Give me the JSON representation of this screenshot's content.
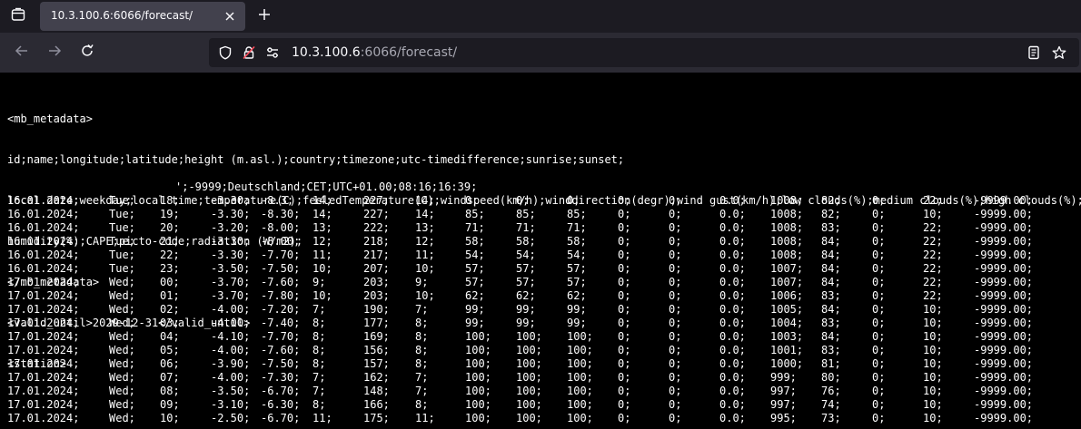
{
  "tab": {
    "title": "10.3.100.6:6066/forecast/"
  },
  "url": {
    "host": "10.3.100.6",
    "rest": ":6066/forecast/"
  },
  "metadata_lines": [
    "<mb_metadata>",
    "id;name;longitude;latitude;height (m.asl.);country;timezone;utc-timedifference;sunrise;sunset;",
    "local date;weekday;local time;temperature(C);feeledTemperature(C);windspeed(km/h);winddirection(degr);wind gust(km/h);low clouds(%);medium clouds(%);high clouds(%);precipitation(mm);",
    "humidity(%);CAPE;picto-code;radiation (W/m2);",
    "</mb_metadata>",
    "<valid_until>2029-12-31</valid_until>",
    "<station>"
  ],
  "station_line": "';-9999;Deutschland;CET;UTC+01.00;08:16;16:39;",
  "rows": [
    [
      "16.01.2024;",
      "Tue;",
      "18;",
      "-3.30;",
      "-8.3;",
      "14;",
      "227;",
      "14;",
      "0;",
      "0;",
      "0;",
      "0;",
      "0;",
      "0.0;",
      "1008;",
      "82;",
      "0;",
      "22;",
      "-9999.00;"
    ],
    [
      "16.01.2024;",
      "Tue;",
      "19;",
      "-3.30;",
      "-8.30;",
      "14;",
      "227;",
      "14;",
      "85;",
      "85;",
      "85;",
      "0;",
      "0;",
      "0.0;",
      "1008;",
      "82;",
      "0;",
      "10;",
      "-9999.00;"
    ],
    [
      "16.01.2024;",
      "Tue;",
      "20;",
      "-3.20;",
      "-8.00;",
      "13;",
      "222;",
      "13;",
      "71;",
      "71;",
      "71;",
      "0;",
      "0;",
      "0.0;",
      "1008;",
      "83;",
      "0;",
      "22;",
      "-9999.00;"
    ],
    [
      "16.01.2024;",
      "Tue;",
      "21;",
      "-3.30;",
      "-8.00;",
      "12;",
      "218;",
      "12;",
      "58;",
      "58;",
      "58;",
      "0;",
      "0;",
      "0.0;",
      "1008;",
      "84;",
      "0;",
      "22;",
      "-9999.00;"
    ],
    [
      "16.01.2024;",
      "Tue;",
      "22;",
      "-3.30;",
      "-7.70;",
      "11;",
      "217;",
      "11;",
      "54;",
      "54;",
      "54;",
      "0;",
      "0;",
      "0.0;",
      "1008;",
      "84;",
      "0;",
      "22;",
      "-9999.00;"
    ],
    [
      "16.01.2024;",
      "Tue;",
      "23;",
      "-3.50;",
      "-7.50;",
      "10;",
      "207;",
      "10;",
      "57;",
      "57;",
      "57;",
      "0;",
      "0;",
      "0.0;",
      "1007;",
      "84;",
      "0;",
      "22;",
      "-9999.00;"
    ],
    [
      "17.01.2024;",
      "Wed;",
      "00;",
      "-3.70;",
      "-7.60;",
      "9;",
      "203;",
      "9;",
      "57;",
      "57;",
      "57;",
      "0;",
      "0;",
      "0.0;",
      "1007;",
      "84;",
      "0;",
      "22;",
      "-9999.00;"
    ],
    [
      "17.01.2024;",
      "Wed;",
      "01;",
      "-3.70;",
      "-7.80;",
      "10;",
      "203;",
      "10;",
      "62;",
      "62;",
      "62;",
      "0;",
      "0;",
      "0.0;",
      "1006;",
      "83;",
      "0;",
      "22;",
      "-9999.00;"
    ],
    [
      "17.01.2024;",
      "Wed;",
      "02;",
      "-4.00;",
      "-7.20;",
      "7;",
      "190;",
      "7;",
      "99;",
      "99;",
      "99;",
      "0;",
      "0;",
      "0.0;",
      "1005;",
      "84;",
      "0;",
      "10;",
      "-9999.00;"
    ],
    [
      "17.01.2024;",
      "Wed;",
      "03;",
      "-4.00;",
      "-7.40;",
      "8;",
      "177;",
      "8;",
      "99;",
      "99;",
      "99;",
      "0;",
      "0;",
      "0.0;",
      "1004;",
      "83;",
      "0;",
      "10;",
      "-9999.00;"
    ],
    [
      "17.01.2024;",
      "Wed;",
      "04;",
      "-4.10;",
      "-7.70;",
      "8;",
      "169;",
      "8;",
      "100;",
      "100;",
      "100;",
      "0;",
      "0;",
      "0.0;",
      "1003;",
      "84;",
      "0;",
      "10;",
      "-9999.00;"
    ],
    [
      "17.01.2024;",
      "Wed;",
      "05;",
      "-4.00;",
      "-7.60;",
      "8;",
      "156;",
      "8;",
      "100;",
      "100;",
      "100;",
      "0;",
      "0;",
      "0.0;",
      "1001;",
      "83;",
      "0;",
      "10;",
      "-9999.00;"
    ],
    [
      "17.01.2024;",
      "Wed;",
      "06;",
      "-3.90;",
      "-7.50;",
      "8;",
      "157;",
      "8;",
      "100;",
      "100;",
      "100;",
      "0;",
      "0;",
      "0.0;",
      "1000;",
      "81;",
      "0;",
      "10;",
      "-9999.00;"
    ],
    [
      "17.01.2024;",
      "Wed;",
      "07;",
      "-4.00;",
      "-7.30;",
      "7;",
      "162;",
      "7;",
      "100;",
      "100;",
      "100;",
      "0;",
      "0;",
      "0.0;",
      "999;",
      "80;",
      "0;",
      "10;",
      "-9999.00;"
    ],
    [
      "17.01.2024;",
      "Wed;",
      "08;",
      "-3.50;",
      "-6.70;",
      "7;",
      "148;",
      "7;",
      "100;",
      "100;",
      "100;",
      "0;",
      "0;",
      "0.0;",
      "997;",
      "76;",
      "0;",
      "10;",
      "-9999.00;"
    ],
    [
      "17.01.2024;",
      "Wed;",
      "09;",
      "-3.10;",
      "-6.30;",
      "8;",
      "166;",
      "8;",
      "100;",
      "100;",
      "100;",
      "0;",
      "0;",
      "0.0;",
      "997;",
      "74;",
      "0;",
      "10;",
      "-9999.00;"
    ],
    [
      "17.01.2024;",
      "Wed;",
      "10;",
      "-2.50;",
      "-6.70;",
      "11;",
      "175;",
      "11;",
      "100;",
      "100;",
      "100;",
      "0;",
      "0;",
      "0.0;",
      "995;",
      "73;",
      "0;",
      "10;",
      "-9999.00;"
    ]
  ],
  "colors": {
    "tab_bar_bg": "#1c1b22",
    "nav_bar_bg": "#2b2a33",
    "active_tab_bg": "#42414d",
    "page_bg": "#000000",
    "text": "#ffffff",
    "url_dim": "#a8a8b2"
  }
}
